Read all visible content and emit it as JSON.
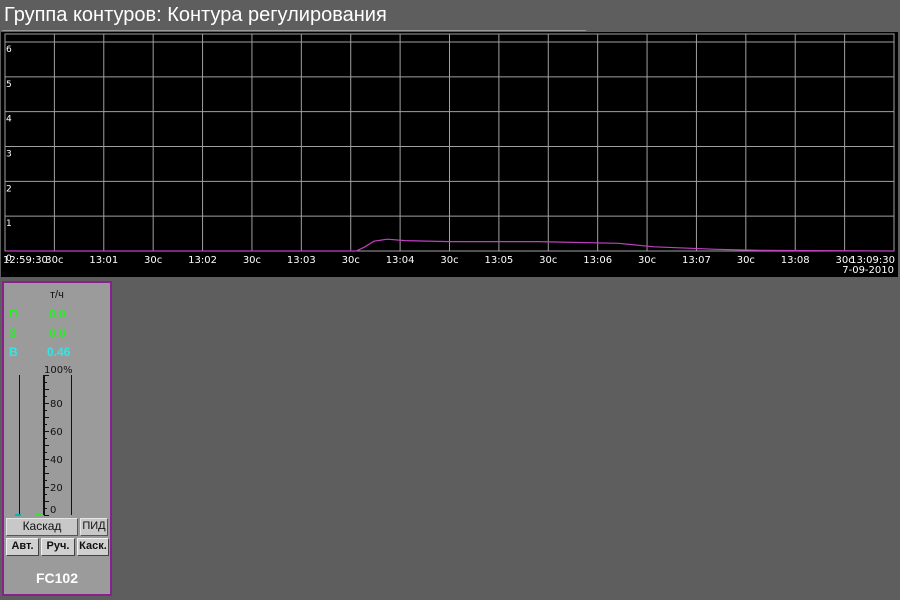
{
  "window": {
    "title": "Группа контуров: Контура регулирования"
  },
  "chart_data": {
    "type": "line",
    "y_tick_labels": [
      "0",
      "1",
      "2",
      "3",
      "4",
      "5",
      "6"
    ],
    "ylim": [
      0,
      6
    ],
    "x_tick_labels": [
      "12:59:30",
      "30с",
      "13:01",
      "30с",
      "13:02",
      "30с",
      "13:03",
      "30с",
      "13:04",
      "30с",
      "13:05",
      "30с",
      "13:06",
      "30с",
      "13:07",
      "30с",
      "13:08",
      "30с",
      "13:09:30"
    ],
    "x_minutes_range": [
      0,
      10
    ],
    "grid": true,
    "date": "7-09-2010",
    "series": [
      {
        "color": "#c040c0",
        "x_minutes": [
          0,
          3.95,
          4.05,
          4.15,
          4.3,
          4.5,
          5.0,
          6.0,
          6.9,
          7.3,
          8.0,
          8.5,
          10
        ],
        "values": [
          0,
          0,
          0.12,
          0.28,
          0.34,
          0.3,
          0.27,
          0.27,
          0.22,
          0.12,
          0.05,
          0.02,
          0
        ]
      }
    ],
    "colors": {
      "background": "#000000",
      "grid": "#a0a0a0",
      "axis_text": "#ffffff"
    }
  },
  "faceplate": {
    "unit": "т/ч",
    "rows": [
      {
        "label": "П",
        "value": "0.0",
        "color": "#2ee82e"
      },
      {
        "label": "З",
        "value": "0.0",
        "color": "#2ee82e"
      },
      {
        "label": "В",
        "value": "0.46",
        "color": "#2ee8e8"
      }
    ],
    "scale_labels": [
      "100%",
      "80",
      "60",
      "40",
      "20",
      "0"
    ],
    "output_percent": 0.46,
    "mode_label": "Каскад",
    "algorithm_label": "ПИД",
    "buttons": {
      "auto": "Авт.",
      "manual": "Руч.",
      "cascade": "Каск."
    },
    "tag": "FC102",
    "border_color": "#8a1f8f"
  }
}
